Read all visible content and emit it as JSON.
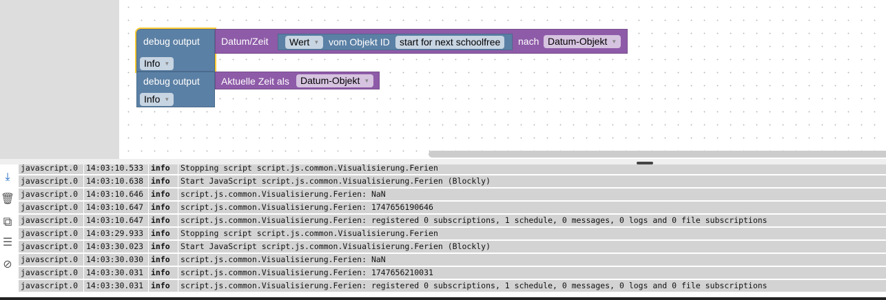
{
  "blocks": [
    {
      "label": "debug output",
      "level": "Info",
      "func": "Datum/Zeit",
      "value_dd": "Wert",
      "obj_label": "vom Objekt ID",
      "obj_id": "start for next schoolfree",
      "nach": "nach",
      "format": "Datum-Objekt"
    },
    {
      "label": "debug output",
      "level": "Info",
      "func": "Aktuelle Zeit als",
      "format": "Datum-Objekt"
    }
  ],
  "toolbar": [
    "scroll-to-bottom-icon",
    "delete-icon",
    "copy-icon",
    "columns-icon",
    "hide-icon"
  ],
  "log": [
    {
      "src": "javascript.0",
      "time": "14:03:10.533",
      "level": "info",
      "msg": "Stopping script script.js.common.Visualisierung.Ferien"
    },
    {
      "src": "javascript.0",
      "time": "14:03:10.638",
      "level": "info",
      "msg": "Start JavaScript script.js.common.Visualisierung.Ferien (Blockly)"
    },
    {
      "src": "javascript.0",
      "time": "14:03:10.646",
      "level": "info",
      "msg": "script.js.common.Visualisierung.Ferien: NaN"
    },
    {
      "src": "javascript.0",
      "time": "14:03:10.647",
      "level": "info",
      "msg": "script.js.common.Visualisierung.Ferien: 1747656190646"
    },
    {
      "src": "javascript.0",
      "time": "14:03:10.647",
      "level": "info",
      "msg": "script.js.common.Visualisierung.Ferien: registered 0 subscriptions, 1 schedule, 0 messages, 0 logs and 0 file subscriptions"
    },
    {
      "src": "javascript.0",
      "time": "14:03:29.933",
      "level": "info",
      "msg": "Stopping script script.js.common.Visualisierung.Ferien"
    },
    {
      "src": "javascript.0",
      "time": "14:03:30.023",
      "level": "info",
      "msg": "Start JavaScript script.js.common.Visualisierung.Ferien (Blockly)"
    },
    {
      "src": "javascript.0",
      "time": "14:03:30.030",
      "level": "info",
      "msg": "script.js.common.Visualisierung.Ferien: NaN"
    },
    {
      "src": "javascript.0",
      "time": "14:03:30.031",
      "level": "info",
      "msg": "script.js.common.Visualisierung.Ferien: 1747656210031"
    },
    {
      "src": "javascript.0",
      "time": "14:03:30.031",
      "level": "info",
      "msg": "script.js.common.Visualisierung.Ferien: registered 0 subscriptions, 1 schedule, 0 messages, 0 logs and 0 file subscriptions"
    }
  ]
}
